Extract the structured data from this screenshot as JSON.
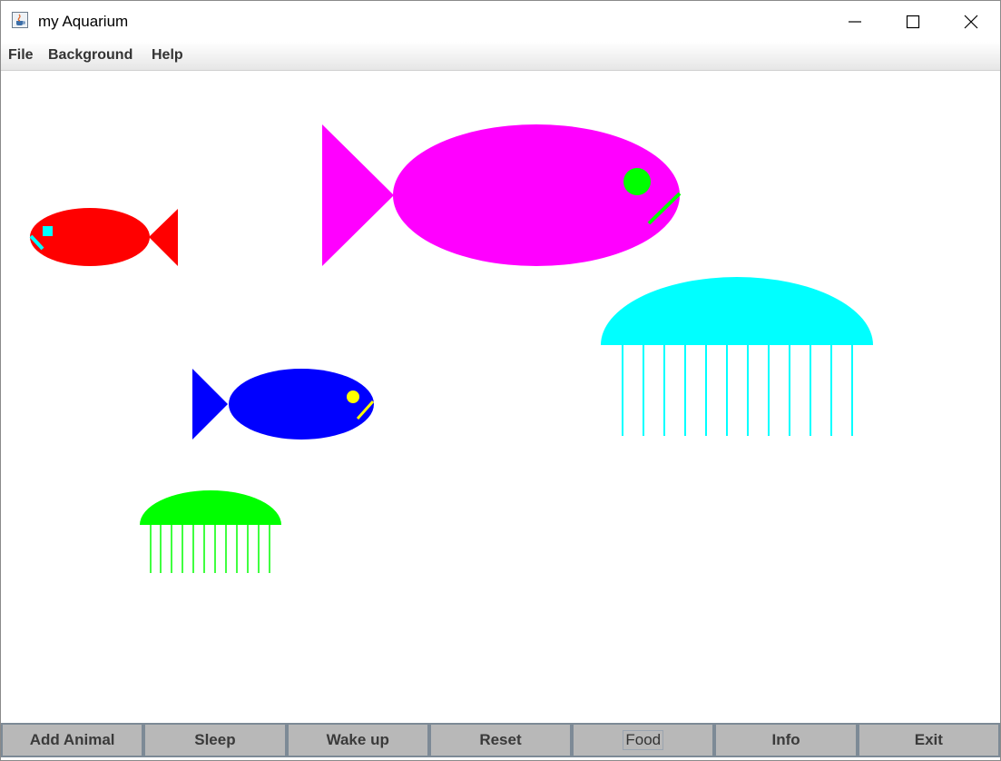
{
  "window": {
    "title": "my Aquarium",
    "icon": "java-cup-icon"
  },
  "menubar": {
    "items": [
      "File",
      "Background",
      "Help"
    ]
  },
  "aquarium": {
    "animals": [
      {
        "kind": "fish",
        "color": "#ff0000",
        "eye_color": "#00ffff",
        "facing": "left"
      },
      {
        "kind": "fish",
        "color": "#ff00ff",
        "eye_color": "#00ff00",
        "facing": "right"
      },
      {
        "kind": "jellyfish",
        "color": "#00ffff"
      },
      {
        "kind": "fish",
        "color": "#0000ff",
        "eye_color": "#ffff00",
        "facing": "right"
      },
      {
        "kind": "jellyfish",
        "color": "#00ff00"
      }
    ]
  },
  "toolbar": {
    "buttons": [
      "Add Animal",
      "Sleep",
      "Wake up",
      "Reset",
      "Food",
      "Info",
      "Exit"
    ]
  }
}
